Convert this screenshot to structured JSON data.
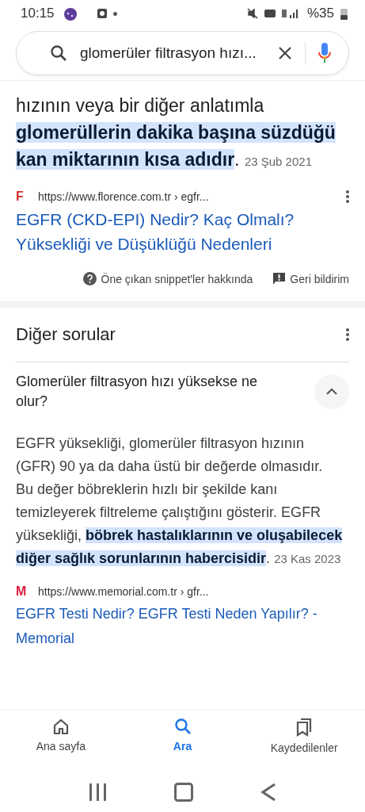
{
  "status_bar": {
    "time": "10:15",
    "battery": "%35"
  },
  "search": {
    "value": "glomerüler filtrasyon hızı..."
  },
  "featured_snippet": {
    "text": "hızının veya bir diğer anlatımla **glomerüllerin dakika başına süzdüğü kan miktarının kısa adıdır**.",
    "date": "23 Şub 2021",
    "source": {
      "favicon": "F",
      "color": "#d32f2f",
      "url": "https://www.florence.com.tr › egfr...",
      "title": "EGFR (CKD-EPI) Nedir? Kaç Olmalı? Yüksekliği ve Düşüklüğü Nedenleri"
    },
    "about": "Öne çıkan snippet'ler hakkında",
    "feedback": "Geri bildirim"
  },
  "other_questions": {
    "title": "Diğer sorular",
    "items": [
      {
        "question": "Glomerüler filtrasyon hızı yüksekse ne olur?",
        "expanded": true,
        "answer": "EGFR yüksekliği, glomerüler filtrasyon hızının (GFR) 90 ya da daha üstü bir değerde olmasıdır. Bu değer böbreklerin hızlı bir şekilde kanı temizleyerek filtreleme çalıştığını gösterir. EGFR yüksekliği, **böbrek hastalıklarının ve oluşabilecek diğer sağlık sorunlarının habercisidir**.",
        "date": "23 Kas 2023",
        "source": {
          "favicon": "M",
          "color": "#d81b3c",
          "url": "https://www.memorial.com.tr › gfr...",
          "title": "EGFR Testi Nedir? EGFR Testi Neden Yapılır? - Memorial"
        }
      }
    ]
  },
  "bottom_nav": [
    {
      "kind": "home",
      "label": "Ana sayfa",
      "selected": false
    },
    {
      "kind": "search",
      "label": "Ara",
      "selected": true
    },
    {
      "kind": "saved",
      "label": "Kaydedilenler",
      "selected": false
    }
  ]
}
